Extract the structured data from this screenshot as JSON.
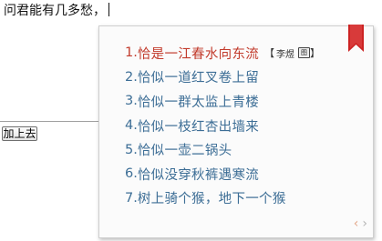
{
  "editor": {
    "text": "问君能有几多愁，"
  },
  "add_button": {
    "label": "加上去"
  },
  "ime": {
    "candidates": [
      {
        "num": "1.",
        "text": "恰是一江春水向东流"
      },
      {
        "num": "2.",
        "text": "恰似一道红叉卷上留"
      },
      {
        "num": "3.",
        "text": "恰似一群太监上青楼"
      },
      {
        "num": "4.",
        "text": "恰似一枝红杏出墙来"
      },
      {
        "num": "5.",
        "text": "恰似一壶二锅头"
      },
      {
        "num": "6.",
        "text": "恰似没穿秋裤遇寒流"
      },
      {
        "num": "7.",
        "text": "树上骑个猴，地下一个猴"
      }
    ],
    "hint": {
      "open_bracket": "【",
      "author": "李煜",
      "icon_glyph": "图",
      "close_bracket": "】"
    },
    "pager": {
      "prev": "‹",
      "next": "›"
    },
    "colors": {
      "first": "#c23b2c",
      "rest": "#3d6e96",
      "bookmark": "#cc2222"
    }
  }
}
